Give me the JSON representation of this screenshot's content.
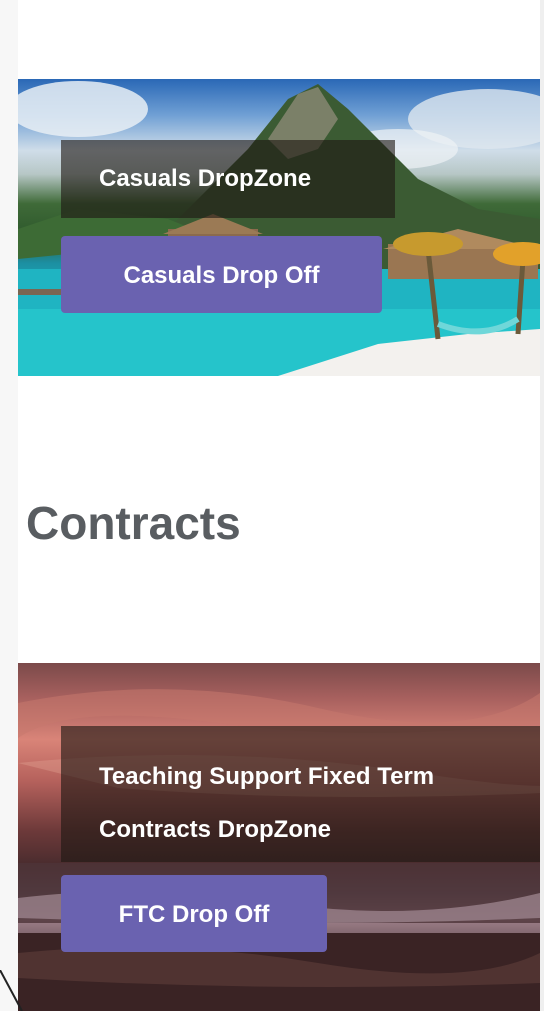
{
  "casuals": {
    "title": "Casuals DropZone",
    "button_label": "Casuals Drop Off"
  },
  "contracts": {
    "heading": "Contracts",
    "title_line1": "Teaching Support Fixed Term",
    "title_line2": "Contracts DropZone",
    "button_label": "FTC Drop Off"
  },
  "colors": {
    "button": "#6a62b0",
    "heading": "#595d61"
  }
}
